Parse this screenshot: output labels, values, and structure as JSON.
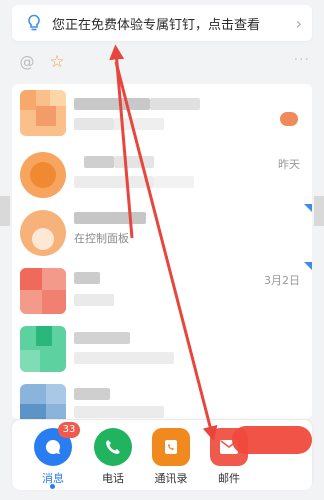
{
  "banner": {
    "text": "您正在免费体验专属钉钉，点击查看",
    "icon": "lightbulb-icon",
    "chevron": "›"
  },
  "filter": {
    "at_icon": "@",
    "star_icon": "☆",
    "more_icon": "···"
  },
  "conversations": [
    {
      "time": "",
      "snippet": ""
    },
    {
      "time": "昨天",
      "snippet": ""
    },
    {
      "time": "",
      "snippet": "在控制面板"
    },
    {
      "time": "3月2日",
      "snippet": ""
    },
    {
      "time": "",
      "snippet": ""
    },
    {
      "time": "",
      "snippet": ""
    }
  ],
  "nav": {
    "tabs": [
      {
        "label": "消息",
        "icon": "chat-bubble-icon",
        "color": "#2a7df0",
        "badge": "33",
        "active": true
      },
      {
        "label": "电话",
        "icon": "phone-icon",
        "color": "#22b35e",
        "badge": "",
        "active": false
      },
      {
        "label": "通讯录",
        "icon": "contacts-icon",
        "color": "#f08a1e",
        "badge": "",
        "active": false
      },
      {
        "label": "邮件",
        "icon": "mail-icon",
        "color": "#f05a4c",
        "badge": "",
        "active": false
      }
    ]
  },
  "colors": {
    "accent": "#2a7df0",
    "annotation_red": "#e8453c",
    "star": "#f0a030"
  }
}
